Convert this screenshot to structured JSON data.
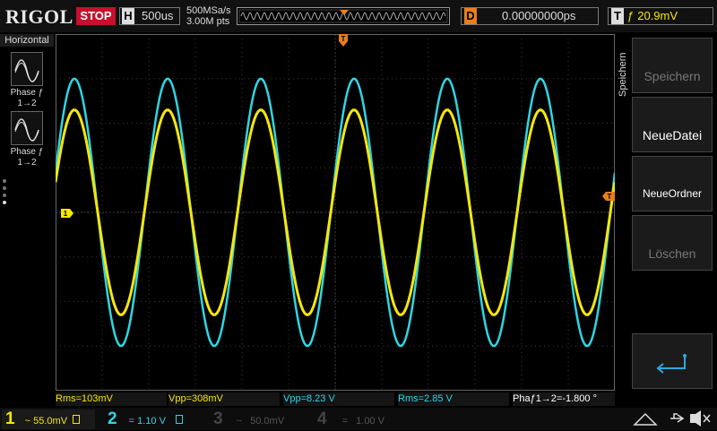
{
  "header": {
    "logo": "RIGOL",
    "run_state": "STOP",
    "timebase_label": "H",
    "timebase_value": "500us",
    "sample_rate": "500MSa/s",
    "memory_depth": "3.00M pts",
    "delay_label": "D",
    "delay_value": "0.00000000ps",
    "trigger_label": "T",
    "trigger_edge": "ƒ",
    "trigger_level": "20.9mV"
  },
  "left_panel": {
    "title": "Horizontal",
    "items": [
      {
        "label": "Phase ƒ",
        "sub": "1→2"
      },
      {
        "label": "Phase ƒ",
        "sub": "1→2"
      }
    ]
  },
  "right_panel": {
    "title": "Speichern",
    "buttons": [
      {
        "label": "Speichern",
        "enabled": false
      },
      {
        "label": "NeueDatei",
        "enabled": true
      },
      {
        "label": "NeueOrdner",
        "enabled": true
      },
      {
        "label": "Löschen",
        "enabled": false
      }
    ]
  },
  "measurements": [
    {
      "text": "Rms=103mV",
      "color": "#f4e60c"
    },
    {
      "text": "Vpp=308mV",
      "color": "#f4e60c"
    },
    {
      "text": "Vpp=8.23 V",
      "color": "#2fd5e3"
    },
    {
      "text": "Rms=2.85 V",
      "color": "#2fd5e3"
    },
    {
      "text": "Phaƒ1→2=-1.800 °",
      "color": "#ffffff"
    }
  ],
  "channels": [
    {
      "num": "1",
      "coupling": "~",
      "scale": "55.0mV",
      "color": "#f4e60c",
      "active": true
    },
    {
      "num": "2",
      "coupling": "=",
      "scale": "1.10 V",
      "color": "#2fd5e3",
      "active": true
    },
    {
      "num": "3",
      "coupling": "~",
      "scale": "50.0mV",
      "color": "#e05ab8",
      "active": false
    },
    {
      "num": "4",
      "coupling": "=",
      "scale": "1.00 V",
      "color": "#4a7fd6",
      "active": false
    }
  ],
  "markers": {
    "trigger_position": "T",
    "ch1_marker": "1",
    "trigger_level_marker": "T"
  },
  "colors": {
    "ch1": "#f4e60c",
    "ch2": "#2fd5e3",
    "grid": "#3a3a3a",
    "trigger": "#e97e1a"
  },
  "waveforms": {
    "cycles_on_screen": 6,
    "ch1_amplitude_divs": 2.3,
    "ch2_amplitude_divs": 3.0
  }
}
